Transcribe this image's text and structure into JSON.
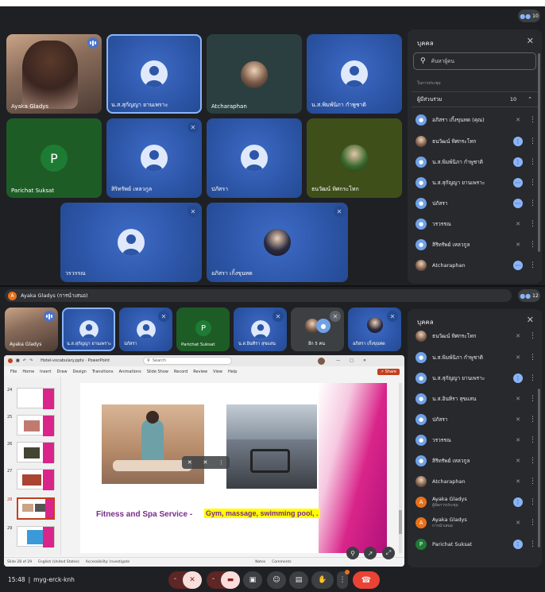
{
  "top": {
    "participant_count": "10"
  },
  "tiles": [
    {
      "name": "Ayaka Gladys"
    },
    {
      "name": "น.ส.สุกัญญา ยานเพราะ"
    },
    {
      "name": "Atcharaphan"
    },
    {
      "name": "น.ส.พิมพ์นิภา กำพูชาติ"
    },
    {
      "name": "Parichat Suksat",
      "initial": "P"
    },
    {
      "name": "สิริทรัพย์ เหลวกูล"
    },
    {
      "name": "ปภัสรา"
    },
    {
      "name": "ธนวัฒน์ ทิศกระโทก"
    },
    {
      "name": "วรวรรณ"
    },
    {
      "name": "อภิสรา เกิ้งขุนทด"
    }
  ],
  "panel1": {
    "title": "บุคคล",
    "search_placeholder": "ค้นหาผู้คน",
    "section": "ในการประชุม",
    "group": "ผู้มีส่วนร่วม",
    "group_count": "10",
    "rows": [
      {
        "name": "อภิสรา เกิ้งขุนทด (คุณ)"
      },
      {
        "name": "ธนวัฒน์ ทิศกระโทก"
      },
      {
        "name": "น.ส.พิมพ์นิภา กำพูชาติ"
      },
      {
        "name": "น.ส.สุกัญญา ยานเพราะ"
      },
      {
        "name": "ปภัสรา"
      },
      {
        "name": "วรวรรณ"
      },
      {
        "name": "สิริทรัพย์ เหลวกูล"
      },
      {
        "name": "Atcharaphan"
      }
    ]
  },
  "presenting_bar": {
    "avatar_letter": "A",
    "label": "Ayaka Gladys (การนำเสนอ)",
    "participant_count": "12"
  },
  "strip": [
    {
      "name": "Ayaka Gladys"
    },
    {
      "name": "น.ส.สุกัญญา ยานเพราะ"
    },
    {
      "name": "ปภัสรา"
    },
    {
      "name": "Parichat Suksat",
      "initial": "P"
    },
    {
      "name": "น.ส.อินทิรา สุขแสน"
    },
    {
      "name": "อีก 5 คน"
    },
    {
      "name": "อภิสรา เกิ้งขุนทด"
    }
  ],
  "panel2": {
    "title": "บุคคล",
    "rows": [
      {
        "name": "ธนวัฒน์ ทิศกระโทก",
        "sub": ""
      },
      {
        "name": "น.ส.พิมพ์นิภา กำพูชาติ",
        "sub": ""
      },
      {
        "name": "น.ส.สุกัญญา ยานเพราะ",
        "sub": ""
      },
      {
        "name": "น.ส.อินทิรา สุขแสน",
        "sub": ""
      },
      {
        "name": "ปภัสรา",
        "sub": ""
      },
      {
        "name": "วรวรรณ",
        "sub": ""
      },
      {
        "name": "สิริทรัพย์ เหลวกูล",
        "sub": ""
      },
      {
        "name": "Atcharaphan",
        "sub": ""
      },
      {
        "name": "Ayaka Gladys",
        "sub": "ผู้จัดการประชุม",
        "initial": "A"
      },
      {
        "name": "Ayaka Gladys",
        "sub": "การนำเสนอ",
        "initial": "A"
      },
      {
        "name": "Parichat Suksat",
        "sub": "",
        "initial": "P"
      }
    ]
  },
  "ppt": {
    "filename": "Hotel-vocabulary.pptx · PowerPoint",
    "search": "Search",
    "share": "Share",
    "menu": [
      "File",
      "Home",
      "Insert",
      "Draw",
      "Design",
      "Transitions",
      "Animations",
      "Slide Show",
      "Record",
      "Review",
      "View",
      "Help"
    ],
    "thumbs": [
      "24",
      "25",
      "26",
      "27",
      "28",
      "29"
    ],
    "slide_title": "Fitness and Spa Service - ",
    "slide_highlight": "Gym, massage, swimming pool, .",
    "status_slide": "Slide 28 of 29",
    "status_lang": "English (United States)",
    "status_access": "Accessibility: Investigate",
    "status_notes": "Notes",
    "status_comments": "Comments"
  },
  "bottom": {
    "time": "15:48",
    "separator": "|",
    "meeting_code": "myg-erck-knh"
  },
  "colors": {
    "bg": "#1f2023",
    "tile_blue": "#2d56a8",
    "panel": "#27292d",
    "accent": "#8ab4f8",
    "end_call": "#ea4335",
    "slide_title": "#7a2a8c",
    "highlight": "#ffff00"
  }
}
